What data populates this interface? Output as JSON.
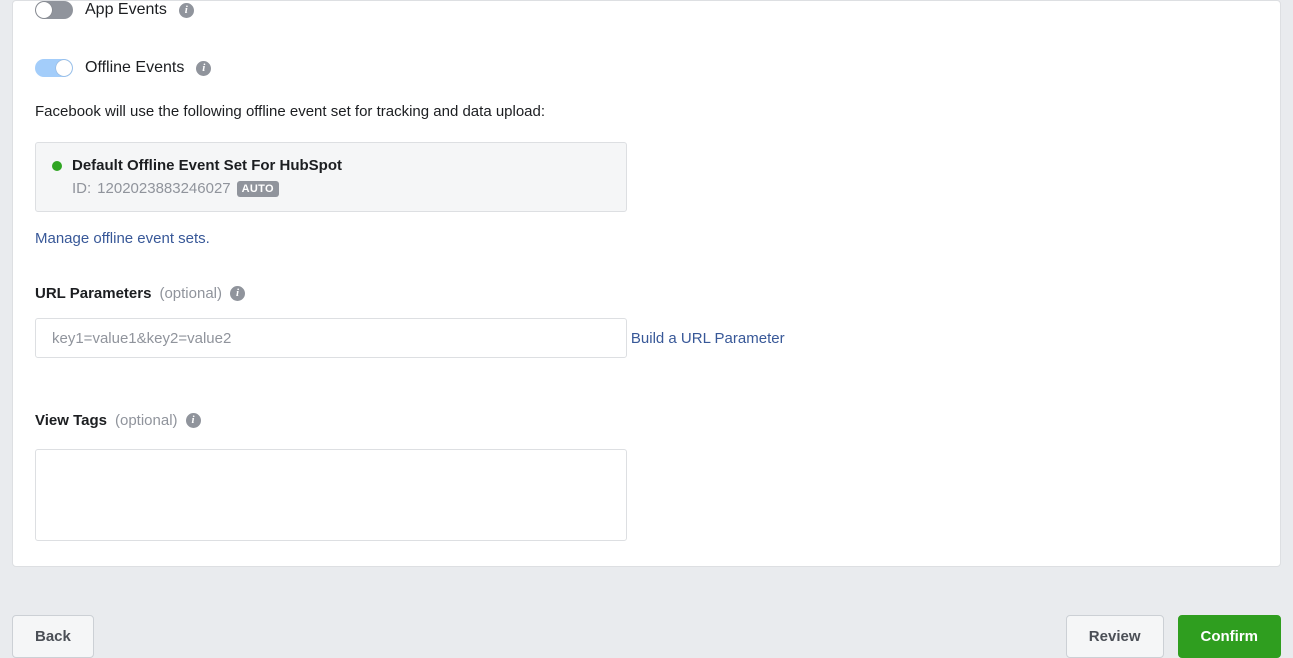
{
  "toggles": {
    "app_events": {
      "label": "App Events",
      "on": false
    },
    "offline_events": {
      "label": "Offline Events",
      "on": true
    }
  },
  "offline_desc": "Facebook will use the following offline event set for tracking and data upload:",
  "event_set": {
    "name": "Default Offline Event Set For HubSpot",
    "id_prefix": "ID:",
    "id": "1202023883246027",
    "badge": "AUTO"
  },
  "manage_link": "Manage offline event sets.",
  "url_params": {
    "label": "URL Parameters",
    "optional": "(optional)",
    "placeholder": "key1=value1&key2=value2",
    "value": "",
    "build_link": "Build a URL Parameter"
  },
  "view_tags": {
    "label": "View Tags",
    "optional": "(optional)",
    "value": ""
  },
  "footer": {
    "back": "Back",
    "review": "Review",
    "confirm": "Confirm"
  },
  "icons": {
    "info": "i"
  }
}
